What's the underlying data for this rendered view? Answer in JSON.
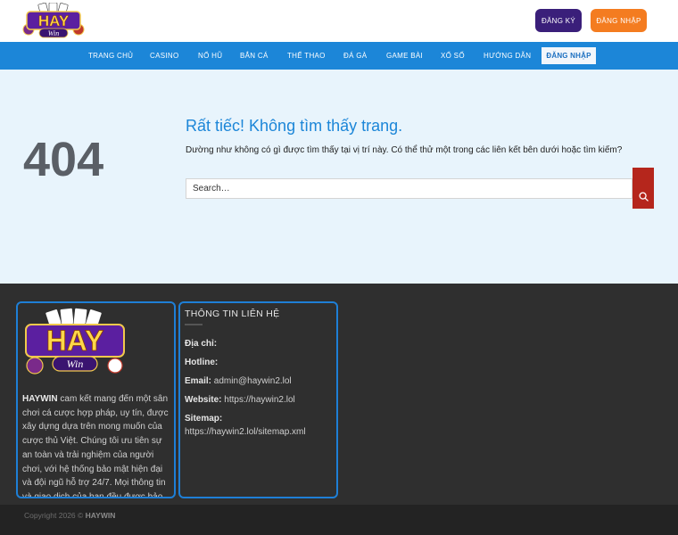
{
  "header": {
    "logo_text": "HAY",
    "logo_sub": "Win",
    "register_label": "ĐĂNG KÝ",
    "login_label": "ĐĂNG NHẬP"
  },
  "nav": {
    "items": [
      "TRANG CHỦ",
      "CASINO",
      "NỔ HŨ",
      "BẮN CÁ",
      "THỂ THAO",
      "ĐÁ GÀ",
      "GAME BÀI",
      "XỔ SỐ",
      "HƯỚNG DẪN"
    ],
    "login_label": "ĐĂNG NHẬP"
  },
  "main": {
    "code": "404",
    "title": "Rất tiếc! Không tìm thấy trang.",
    "description": "Dường như không có gì được tìm thấy tại vị trí này. Có thể thử một trong các liên kết bên dưới hoặc tìm kiếm?",
    "search_placeholder": "Search…",
    "search_icon": "search-icon"
  },
  "footer": {
    "about_brand": "HAYWIN",
    "about_text": " cam kết mang đến một sân chơi cá cược hợp pháp, uy tín, được xây dựng dựa trên mong muốn của cược thủ Việt. Chúng tôi ưu tiên sự an toàn và trải nghiệm của người chơi, với hệ thống bảo mật hiện đại và đội ngũ hỗ trợ 24/7. Mọi thông tin và giao dịch của bạn đều được bảo vệ tuyệt đối.",
    "contact_title": "THÔNG TIN LIÊN HỆ",
    "address_label": "Địa chỉ:",
    "hotline_label": "Hotline:",
    "email_label": "Email:",
    "email_value": "admin@haywin2.lol",
    "website_label": "Website:",
    "website_value": "https://haywin2.lol",
    "sitemap_label": "Sitemap:",
    "sitemap_value": "https://haywin2.lol/sitemap.xml"
  },
  "bottom": {
    "copyright": "Copyright 2026 ©",
    "brand": "HAYWIN"
  },
  "colors": {
    "nav_blue": "#1c86d8",
    "register_purple": "#3a1f7a",
    "login_orange": "#f47c20",
    "search_red": "#b5261c",
    "widget_border": "#1e7fd6"
  }
}
